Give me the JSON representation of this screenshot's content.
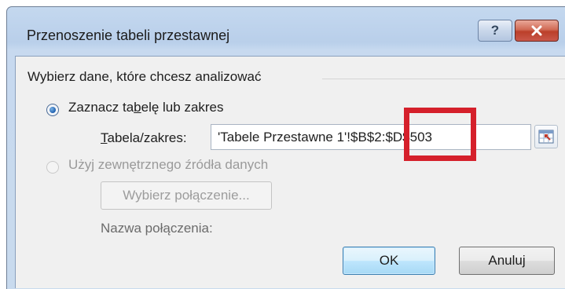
{
  "dialog": {
    "title": "Przenoszenie tabeli przestawnej",
    "help_label": "?",
    "close_label": "✕"
  },
  "group": {
    "label": "Wybierz dane, które chcesz analizować"
  },
  "options": {
    "select_range": {
      "label": "Zaznacz tabelę lub zakres",
      "selected": true
    },
    "external_source": {
      "label": "Użyj zewnętrznego źródła danych",
      "selected": false,
      "enabled": false
    }
  },
  "range": {
    "label": "Tabela/zakres:",
    "value": "'Tabele Przestawne 1'!$B$2:$D$503"
  },
  "connection": {
    "button_label": "Wybierz połączenie...",
    "name_label": "Nazwa połączenia:"
  },
  "buttons": {
    "ok": "OK",
    "cancel": "Anuluj"
  },
  "colors": {
    "highlight": "#d5202b",
    "title_bar": "#b9cfea",
    "client_bg": "#f0f0f0"
  }
}
